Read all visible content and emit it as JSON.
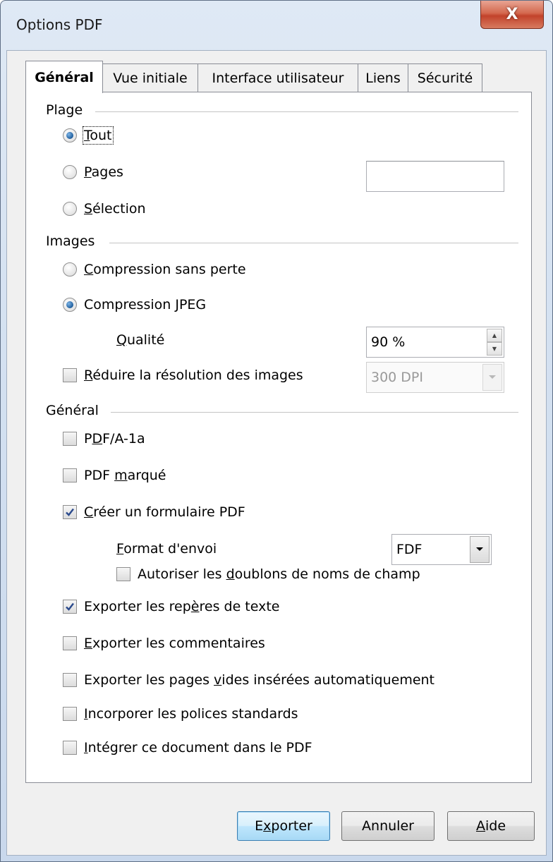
{
  "window": {
    "title": "Options PDF",
    "close_glyph": "X"
  },
  "tabs": [
    {
      "label": "Général",
      "active": true
    },
    {
      "label": "Vue initiale",
      "active": false
    },
    {
      "label": "Interface utilisateur",
      "active": false
    },
    {
      "label": "Liens",
      "active": false
    },
    {
      "label": "Sécurité",
      "active": false
    }
  ],
  "plage": {
    "heading": "Plage",
    "tout": {
      "accel": "T",
      "rest": "out",
      "selected": true
    },
    "pages": {
      "accel": "P",
      "rest": "ages",
      "selected": false,
      "value": ""
    },
    "selection": {
      "accel": "S",
      "rest": "élection",
      "selected": false
    }
  },
  "images": {
    "heading": "Images",
    "lossless": {
      "accel": "C",
      "rest": "ompression sans perte",
      "selected": false
    },
    "jpeg": {
      "pre": "Compression ",
      "accel": "J",
      "rest": "PEG",
      "selected": true
    },
    "quality_label": {
      "accel": "Q",
      "rest": "ualité"
    },
    "quality_value": "90 %",
    "reduce": {
      "accel": "R",
      "rest": "éduire la résolution des images",
      "checked": false
    },
    "dpi_value": "300 DPI"
  },
  "general": {
    "heading": "Général",
    "pdfa": {
      "pre": "P",
      "accel": "D",
      "rest": "F/A-1a",
      "checked": false
    },
    "tagged": {
      "pre": "PDF ",
      "accel": "m",
      "rest": "arqué",
      "checked": false
    },
    "form": {
      "pre": "",
      "accel": "C",
      "rest": "réer un formulaire PDF",
      "checked": true
    },
    "submit_format_label": {
      "accel": "F",
      "rest": "ormat d'envoi"
    },
    "submit_format_value": "FDF",
    "allow_duplicates": {
      "pre": "Autoriser les ",
      "accel": "d",
      "rest": "oublons de noms de champ",
      "checked": false
    },
    "bookmarks": {
      "pre": "Exporter les rep",
      "accel": "è",
      "rest": "res de texte",
      "checked": true
    },
    "comments": {
      "pre": "",
      "accel": "E",
      "rest": "xporter les commentaires",
      "checked": false
    },
    "empty_pages": {
      "pre": "Exporter les pages ",
      "accel": "v",
      "rest": "ides insérées automatiquement",
      "checked": false
    },
    "std_fonts": {
      "pre": "",
      "accel": "I",
      "rest": "ncorporer les polices standards",
      "checked": false
    },
    "embed_doc": {
      "pre": "",
      "accel": "I",
      "rest": "ntégrer ce document dans le PDF",
      "checked": false
    }
  },
  "buttons": {
    "export": {
      "pre": "E",
      "accel": "x",
      "rest": "porter"
    },
    "cancel": "Annuler",
    "help": {
      "accel": "A",
      "rest": "ide"
    }
  }
}
